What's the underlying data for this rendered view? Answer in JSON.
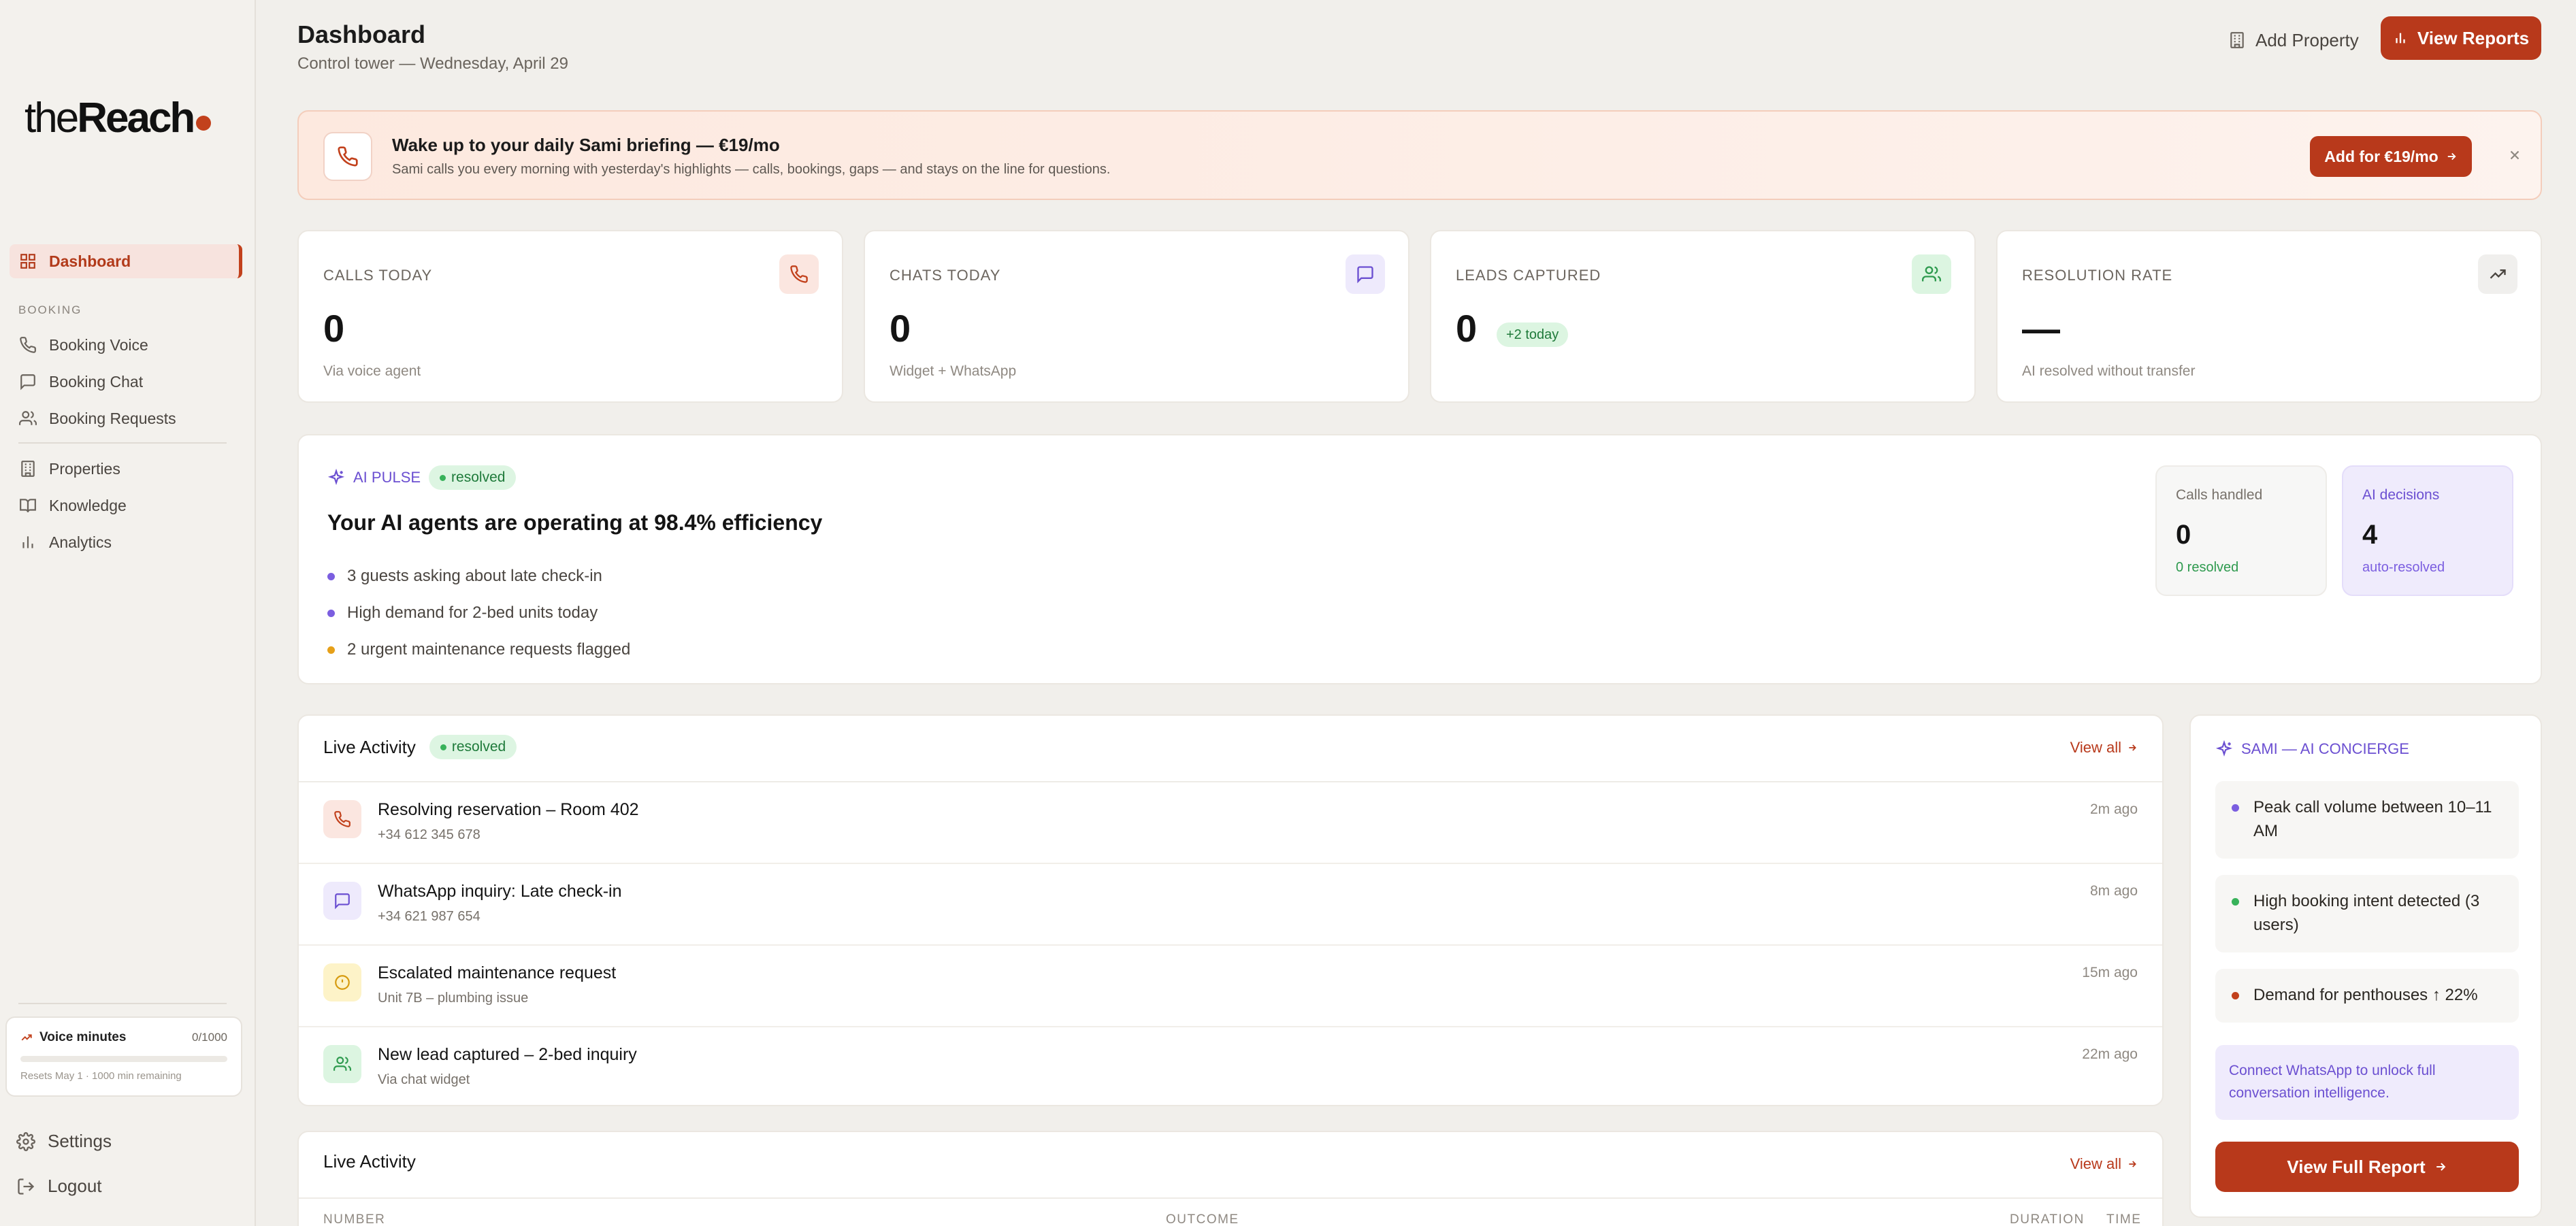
{
  "brand": {
    "the": "the",
    "reach": "Reach"
  },
  "sidebar": {
    "dashboard": "Dashboard",
    "section_booking": "BOOKING",
    "booking_items": [
      "Booking Voice",
      "Booking Chat",
      "Booking Requests"
    ],
    "other_items": [
      "Properties",
      "Knowledge",
      "Analytics"
    ],
    "voice": {
      "title": "Voice minutes",
      "count": "0/1000",
      "used_fraction": 0,
      "reset": "Resets May 1 · 1000 min remaining"
    },
    "settings": "Settings",
    "logout": "Logout"
  },
  "header": {
    "title": "Dashboard",
    "subtitle": "Control tower — Wednesday, April 29",
    "add_property": "Add Property",
    "view_reports": "View Reports"
  },
  "banner": {
    "title": "Wake up to your daily Sami briefing — €19/mo",
    "desc": "Sami calls you every morning with yesterday's highlights — calls, bookings, gaps — and stays on the line for questions.",
    "cta": "Add for €19/mo"
  },
  "stats": [
    {
      "label": "CALLS TODAY",
      "value": "0",
      "sub": "Via voice agent",
      "icon": "phone-icon"
    },
    {
      "label": "CHATS TODAY",
      "value": "0",
      "sub": "Widget + WhatsApp",
      "icon": "chat-icon"
    },
    {
      "label": "LEADS CAPTURED",
      "value": "0",
      "badge": "+2 today",
      "icon": "users-icon"
    },
    {
      "label": "RESOLUTION RATE",
      "value": "—",
      "sub": "AI resolved without transfer",
      "icon": "trend-icon"
    }
  ],
  "pulse": {
    "tag": "AI PULSE",
    "badge": "resolved",
    "headline": "Your AI agents are operating at 98.4% efficiency",
    "bullets": [
      {
        "text": "3 guests asking about late check-in",
        "color": "#7b5ee0"
      },
      {
        "text": "High demand for 2-bed units today",
        "color": "#7b5ee0"
      },
      {
        "text": "2 urgent maintenance requests flagged",
        "color": "#e6a019"
      }
    ],
    "calls": {
      "label": "Calls handled",
      "value": "0",
      "sub": "0 resolved"
    },
    "decisions": {
      "label": "AI decisions",
      "value": "4",
      "sub": "auto-resolved"
    }
  },
  "activity": {
    "title": "Live Activity",
    "badge": "resolved",
    "view_all": "View all",
    "rows": [
      {
        "title": "Resolving reservation – Room 402",
        "sub": "+34 612 345 678",
        "time": "2m ago",
        "icon": "phone-icon"
      },
      {
        "title": "WhatsApp inquiry: Late check-in",
        "sub": "+34 621 987 654",
        "time": "8m ago",
        "icon": "chat-icon"
      },
      {
        "title": "Escalated maintenance request",
        "sub": "Unit 7B – plumbing issue",
        "time": "15m ago",
        "icon": "alert-icon"
      },
      {
        "title": "New lead captured – 2-bed inquiry",
        "sub": "Via chat widget",
        "time": "22m ago",
        "icon": "users-icon"
      }
    ]
  },
  "table": {
    "title": "Live Activity",
    "view_all": "View all",
    "columns": [
      "NUMBER",
      "OUTCOME",
      "DURATION",
      "TIME"
    ]
  },
  "sami": {
    "tag": "SAMI — AI CONCIERGE",
    "insights": [
      {
        "text": "Peak call volume between 10–11 AM",
        "color": "#7b5ee0"
      },
      {
        "text": "High booking intent detected (3 users)",
        "color": "#38b25a"
      },
      {
        "text": "Demand for penthouses ↑ 22%",
        "color": "#c2411c"
      }
    ],
    "connect": "Connect WhatsApp to unlock full conversation intelligence.",
    "report": "View Full Report"
  }
}
